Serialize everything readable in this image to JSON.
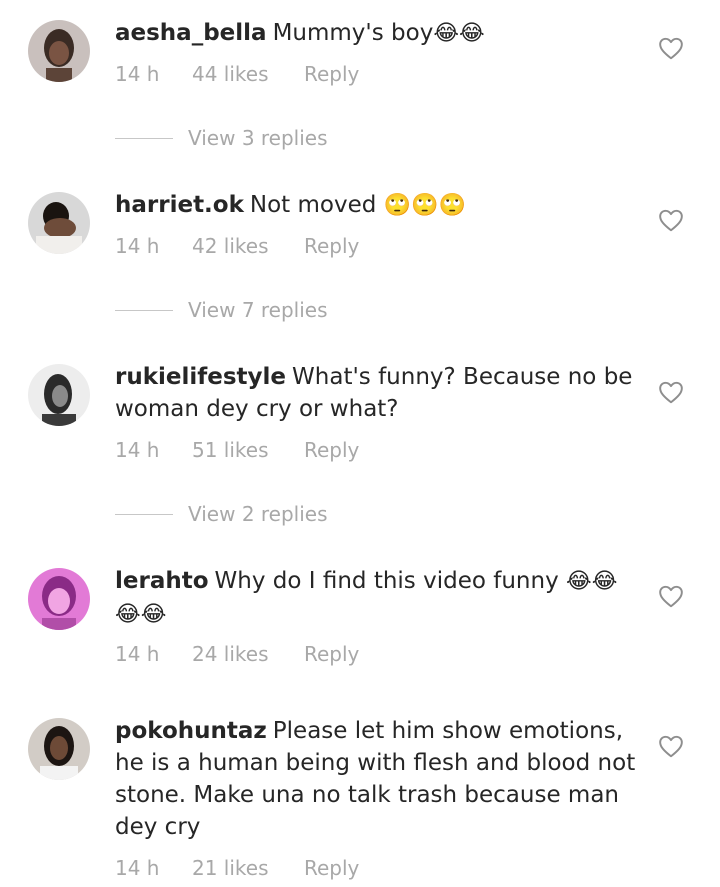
{
  "comments": [
    {
      "username": "aesha_bella",
      "text": "Mummy's boy",
      "emoji": "😂😂",
      "time": "14 h",
      "likes": "44 likes",
      "reply": "Reply",
      "view_replies": "View 3 replies"
    },
    {
      "username": "harriet.ok",
      "text": "Not moved",
      "emoji": "🙄🙄🙄",
      "time": "14 h",
      "likes": "42 likes",
      "reply": "Reply",
      "view_replies": "View 7 replies"
    },
    {
      "username": "rukielifestyle",
      "text": "What's funny? Because no be woman dey cry or what?",
      "emoji": "",
      "time": "14 h",
      "likes": "51 likes",
      "reply": "Reply",
      "view_replies": "View 2 replies"
    },
    {
      "username": "lerahto",
      "text": "Why do I find this video funny",
      "emoji": "😂😂 😂😂",
      "time": "14 h",
      "likes": "24 likes",
      "reply": "Reply",
      "view_replies": ""
    },
    {
      "username": "pokohuntaz",
      "text": "Please let him show emotions, he is a human being with flesh and blood not stone. Make una no talk trash because man dey cry",
      "emoji": "",
      "time": "14 h",
      "likes": "21 likes",
      "reply": "Reply",
      "view_replies": ""
    }
  ],
  "colors": {
    "text": "#262626",
    "meta": "#a8a8a8",
    "divider": "#c7c7c7"
  }
}
